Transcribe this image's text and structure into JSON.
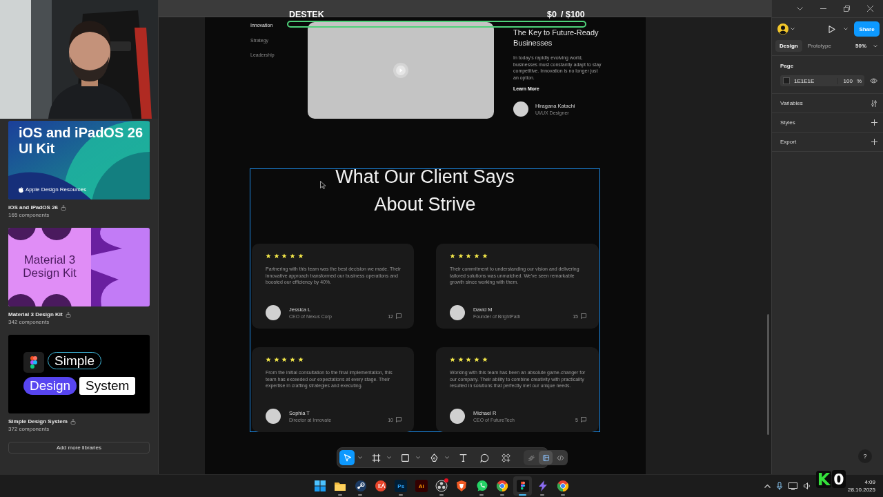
{
  "stream_overlay": {
    "title": "DESTEK",
    "amount": "$0",
    "goal": "/ $100",
    "badge_letter": "K",
    "counter": "0"
  },
  "libraries": {
    "items": [
      {
        "name": "iOS and iPadOS 26",
        "count": "165 components",
        "thumbnail": {
          "kind": "ios",
          "lines": [
            "iOS and iPadOS 26",
            "UI Kit"
          ],
          "footer": "Apple Design Resources"
        }
      },
      {
        "name": "Material 3 Design Kit",
        "count": "342 components",
        "thumbnail": {
          "kind": "material",
          "lines": [
            "Material 3",
            "Design Kit"
          ]
        }
      },
      {
        "name": "Simple Design System",
        "count": "372 components",
        "thumbnail": {
          "kind": "simple",
          "lines": [
            "Simple",
            "Design",
            "System"
          ]
        }
      }
    ],
    "add_button": "Add more libraries"
  },
  "canvas": {
    "nav": [
      {
        "label": "Innovation",
        "selected": true
      },
      {
        "label": "Strategy",
        "selected": false
      },
      {
        "label": "Leadership",
        "selected": false
      }
    ],
    "feature": {
      "title": "The Key to Future-Ready Businesses",
      "body": "In today's rapidly evolving world, businesses must constantly adapt to stay competitive. Innovation is no longer just an option.",
      "link": "Learn More",
      "author": {
        "name": "Hiragana Katachi",
        "role": "UI/UX Designer"
      }
    },
    "testimonials": {
      "title": "What Our Client Says About Strive",
      "cards": [
        {
          "stars": 5,
          "quote": "Partnering with this team was the best decision we made. Their innovative approach transformed our business operations and boosted our efficiency by 40%.",
          "name": "Jessica L",
          "role": "CEO of Nexus Corp",
          "comments": "12"
        },
        {
          "stars": 5,
          "quote": "Their commitment to understanding our vision and delivering tailored solutions was unmatched. We've seen remarkable growth since working with them.",
          "name": "David M",
          "role": "Founder of BrightPath",
          "comments": "15"
        },
        {
          "stars": 5,
          "quote": "From the initial consultation to the final implementation, this team has exceeded our expectations at every stage. Their expertise in crafting strategies and executing.",
          "name": "Sophia T",
          "role": "Director at Innovate",
          "comments": "10"
        },
        {
          "stars": 5,
          "quote": "Working with this team has been an absolute game-changer for our company. Their ability to combine creativity with practicality resulted in solutions that perfectly met our unique needs.",
          "name": "Michael R",
          "role": "CEO of FutureTech",
          "comments": "5"
        }
      ]
    }
  },
  "toolbar": {
    "tools": [
      {
        "kind": "move",
        "selected": true,
        "menu": true
      },
      {
        "kind": "frame",
        "selected": false,
        "menu": true
      },
      {
        "kind": "rectangle",
        "selected": false,
        "menu": true
      },
      {
        "kind": "pen",
        "selected": false,
        "menu": true
      },
      {
        "kind": "text",
        "selected": false,
        "menu": false
      },
      {
        "kind": "comment",
        "selected": false,
        "menu": false
      },
      {
        "kind": "components",
        "selected": false,
        "menu": false
      }
    ],
    "modes": [
      {
        "kind": "draw",
        "selected": false
      },
      {
        "kind": "design",
        "selected": true
      },
      {
        "kind": "dev",
        "selected": false
      }
    ]
  },
  "right_panel": {
    "share": "Share",
    "tabs": [
      {
        "label": "Design",
        "selected": true
      },
      {
        "label": "Prototype",
        "selected": false
      }
    ],
    "zoom": "50%",
    "page": {
      "heading": "Page",
      "color": "1E1E1E",
      "opacity": "100",
      "unit": "%"
    },
    "sections": [
      {
        "label": "Variables",
        "kind": "variables"
      },
      {
        "label": "Styles",
        "kind": "add"
      },
      {
        "label": "Export",
        "kind": "add"
      }
    ],
    "help": "?"
  },
  "taskbar": {
    "apps": [
      {
        "kind": "windows",
        "selected": false,
        "running": false,
        "notification": false
      },
      {
        "kind": "folder",
        "selected": false,
        "running": true,
        "notification": false
      },
      {
        "kind": "steam",
        "selected": false,
        "running": true,
        "notification": false
      },
      {
        "kind": "ea",
        "selected": false,
        "running": false,
        "notification": false
      },
      {
        "kind": "ps",
        "label": "Ps",
        "selected": false,
        "running": true,
        "notification": false
      },
      {
        "kind": "ai",
        "label": "Ai",
        "selected": false,
        "running": false,
        "notification": false
      },
      {
        "kind": "obs",
        "selected": false,
        "running": true,
        "notification": true
      },
      {
        "kind": "brave",
        "selected": false,
        "running": false,
        "notification": false
      },
      {
        "kind": "whatsapp",
        "selected": false,
        "running": true,
        "notification": false
      },
      {
        "kind": "chrome",
        "selected": false,
        "running": true,
        "notification": false
      },
      {
        "kind": "figma",
        "selected": true,
        "running": true,
        "notification": false
      },
      {
        "kind": "bolt",
        "selected": false,
        "running": true,
        "notification": false
      },
      {
        "kind": "chrome",
        "selected": false,
        "running": true,
        "notification": false
      }
    ],
    "time": "4:09",
    "date": "28.10.2025"
  }
}
